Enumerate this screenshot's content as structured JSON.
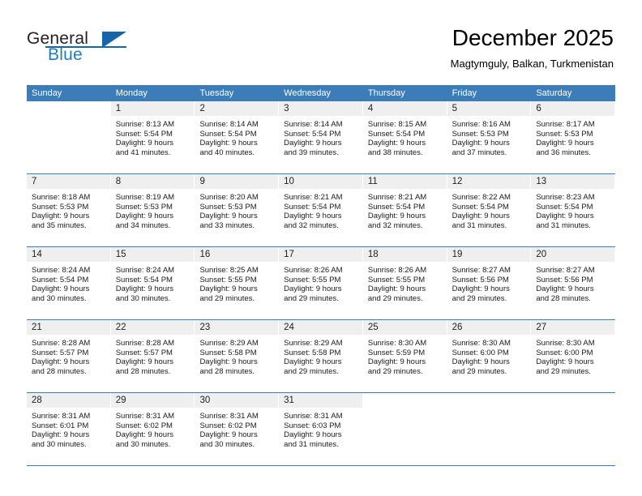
{
  "brand": {
    "name_top": "General",
    "name_bottom": "Blue",
    "accent_color": "#1565a8",
    "blue_text_color": "#1d7cc4"
  },
  "header": {
    "title": "December 2025",
    "subtitle": "Magtymguly, Balkan, Turkmenistan"
  },
  "calendar": {
    "header_color": "#3c7cb8",
    "daynum_bg": "#efefef",
    "weekdays": [
      "Sunday",
      "Monday",
      "Tuesday",
      "Wednesday",
      "Thursday",
      "Friday",
      "Saturday"
    ],
    "weeks": [
      [
        {
          "day": "",
          "sunrise": "",
          "sunset": "",
          "daylight_line1": "",
          "daylight_line2": ""
        },
        {
          "day": "1",
          "sunrise": "Sunrise: 8:13 AM",
          "sunset": "Sunset: 5:54 PM",
          "daylight_line1": "Daylight: 9 hours",
          "daylight_line2": "and 41 minutes."
        },
        {
          "day": "2",
          "sunrise": "Sunrise: 8:14 AM",
          "sunset": "Sunset: 5:54 PM",
          "daylight_line1": "Daylight: 9 hours",
          "daylight_line2": "and 40 minutes."
        },
        {
          "day": "3",
          "sunrise": "Sunrise: 8:14 AM",
          "sunset": "Sunset: 5:54 PM",
          "daylight_line1": "Daylight: 9 hours",
          "daylight_line2": "and 39 minutes."
        },
        {
          "day": "4",
          "sunrise": "Sunrise: 8:15 AM",
          "sunset": "Sunset: 5:54 PM",
          "daylight_line1": "Daylight: 9 hours",
          "daylight_line2": "and 38 minutes."
        },
        {
          "day": "5",
          "sunrise": "Sunrise: 8:16 AM",
          "sunset": "Sunset: 5:53 PM",
          "daylight_line1": "Daylight: 9 hours",
          "daylight_line2": "and 37 minutes."
        },
        {
          "day": "6",
          "sunrise": "Sunrise: 8:17 AM",
          "sunset": "Sunset: 5:53 PM",
          "daylight_line1": "Daylight: 9 hours",
          "daylight_line2": "and 36 minutes."
        }
      ],
      [
        {
          "day": "7",
          "sunrise": "Sunrise: 8:18 AM",
          "sunset": "Sunset: 5:53 PM",
          "daylight_line1": "Daylight: 9 hours",
          "daylight_line2": "and 35 minutes."
        },
        {
          "day": "8",
          "sunrise": "Sunrise: 8:19 AM",
          "sunset": "Sunset: 5:53 PM",
          "daylight_line1": "Daylight: 9 hours",
          "daylight_line2": "and 34 minutes."
        },
        {
          "day": "9",
          "sunrise": "Sunrise: 8:20 AM",
          "sunset": "Sunset: 5:53 PM",
          "daylight_line1": "Daylight: 9 hours",
          "daylight_line2": "and 33 minutes."
        },
        {
          "day": "10",
          "sunrise": "Sunrise: 8:21 AM",
          "sunset": "Sunset: 5:54 PM",
          "daylight_line1": "Daylight: 9 hours",
          "daylight_line2": "and 32 minutes."
        },
        {
          "day": "11",
          "sunrise": "Sunrise: 8:21 AM",
          "sunset": "Sunset: 5:54 PM",
          "daylight_line1": "Daylight: 9 hours",
          "daylight_line2": "and 32 minutes."
        },
        {
          "day": "12",
          "sunrise": "Sunrise: 8:22 AM",
          "sunset": "Sunset: 5:54 PM",
          "daylight_line1": "Daylight: 9 hours",
          "daylight_line2": "and 31 minutes."
        },
        {
          "day": "13",
          "sunrise": "Sunrise: 8:23 AM",
          "sunset": "Sunset: 5:54 PM",
          "daylight_line1": "Daylight: 9 hours",
          "daylight_line2": "and 31 minutes."
        }
      ],
      [
        {
          "day": "14",
          "sunrise": "Sunrise: 8:24 AM",
          "sunset": "Sunset: 5:54 PM",
          "daylight_line1": "Daylight: 9 hours",
          "daylight_line2": "and 30 minutes."
        },
        {
          "day": "15",
          "sunrise": "Sunrise: 8:24 AM",
          "sunset": "Sunset: 5:54 PM",
          "daylight_line1": "Daylight: 9 hours",
          "daylight_line2": "and 30 minutes."
        },
        {
          "day": "16",
          "sunrise": "Sunrise: 8:25 AM",
          "sunset": "Sunset: 5:55 PM",
          "daylight_line1": "Daylight: 9 hours",
          "daylight_line2": "and 29 minutes."
        },
        {
          "day": "17",
          "sunrise": "Sunrise: 8:26 AM",
          "sunset": "Sunset: 5:55 PM",
          "daylight_line1": "Daylight: 9 hours",
          "daylight_line2": "and 29 minutes."
        },
        {
          "day": "18",
          "sunrise": "Sunrise: 8:26 AM",
          "sunset": "Sunset: 5:55 PM",
          "daylight_line1": "Daylight: 9 hours",
          "daylight_line2": "and 29 minutes."
        },
        {
          "day": "19",
          "sunrise": "Sunrise: 8:27 AM",
          "sunset": "Sunset: 5:56 PM",
          "daylight_line1": "Daylight: 9 hours",
          "daylight_line2": "and 29 minutes."
        },
        {
          "day": "20",
          "sunrise": "Sunrise: 8:27 AM",
          "sunset": "Sunset: 5:56 PM",
          "daylight_line1": "Daylight: 9 hours",
          "daylight_line2": "and 28 minutes."
        }
      ],
      [
        {
          "day": "21",
          "sunrise": "Sunrise: 8:28 AM",
          "sunset": "Sunset: 5:57 PM",
          "daylight_line1": "Daylight: 9 hours",
          "daylight_line2": "and 28 minutes."
        },
        {
          "day": "22",
          "sunrise": "Sunrise: 8:28 AM",
          "sunset": "Sunset: 5:57 PM",
          "daylight_line1": "Daylight: 9 hours",
          "daylight_line2": "and 28 minutes."
        },
        {
          "day": "23",
          "sunrise": "Sunrise: 8:29 AM",
          "sunset": "Sunset: 5:58 PM",
          "daylight_line1": "Daylight: 9 hours",
          "daylight_line2": "and 28 minutes."
        },
        {
          "day": "24",
          "sunrise": "Sunrise: 8:29 AM",
          "sunset": "Sunset: 5:58 PM",
          "daylight_line1": "Daylight: 9 hours",
          "daylight_line2": "and 29 minutes."
        },
        {
          "day": "25",
          "sunrise": "Sunrise: 8:30 AM",
          "sunset": "Sunset: 5:59 PM",
          "daylight_line1": "Daylight: 9 hours",
          "daylight_line2": "and 29 minutes."
        },
        {
          "day": "26",
          "sunrise": "Sunrise: 8:30 AM",
          "sunset": "Sunset: 6:00 PM",
          "daylight_line1": "Daylight: 9 hours",
          "daylight_line2": "and 29 minutes."
        },
        {
          "day": "27",
          "sunrise": "Sunrise: 8:30 AM",
          "sunset": "Sunset: 6:00 PM",
          "daylight_line1": "Daylight: 9 hours",
          "daylight_line2": "and 29 minutes."
        }
      ],
      [
        {
          "day": "28",
          "sunrise": "Sunrise: 8:31 AM",
          "sunset": "Sunset: 6:01 PM",
          "daylight_line1": "Daylight: 9 hours",
          "daylight_line2": "and 30 minutes."
        },
        {
          "day": "29",
          "sunrise": "Sunrise: 8:31 AM",
          "sunset": "Sunset: 6:02 PM",
          "daylight_line1": "Daylight: 9 hours",
          "daylight_line2": "and 30 minutes."
        },
        {
          "day": "30",
          "sunrise": "Sunrise: 8:31 AM",
          "sunset": "Sunset: 6:02 PM",
          "daylight_line1": "Daylight: 9 hours",
          "daylight_line2": "and 30 minutes."
        },
        {
          "day": "31",
          "sunrise": "Sunrise: 8:31 AM",
          "sunset": "Sunset: 6:03 PM",
          "daylight_line1": "Daylight: 9 hours",
          "daylight_line2": "and 31 minutes."
        },
        {
          "day": "",
          "sunrise": "",
          "sunset": "",
          "daylight_line1": "",
          "daylight_line2": ""
        },
        {
          "day": "",
          "sunrise": "",
          "sunset": "",
          "daylight_line1": "",
          "daylight_line2": ""
        },
        {
          "day": "",
          "sunrise": "",
          "sunset": "",
          "daylight_line1": "",
          "daylight_line2": ""
        }
      ]
    ]
  }
}
